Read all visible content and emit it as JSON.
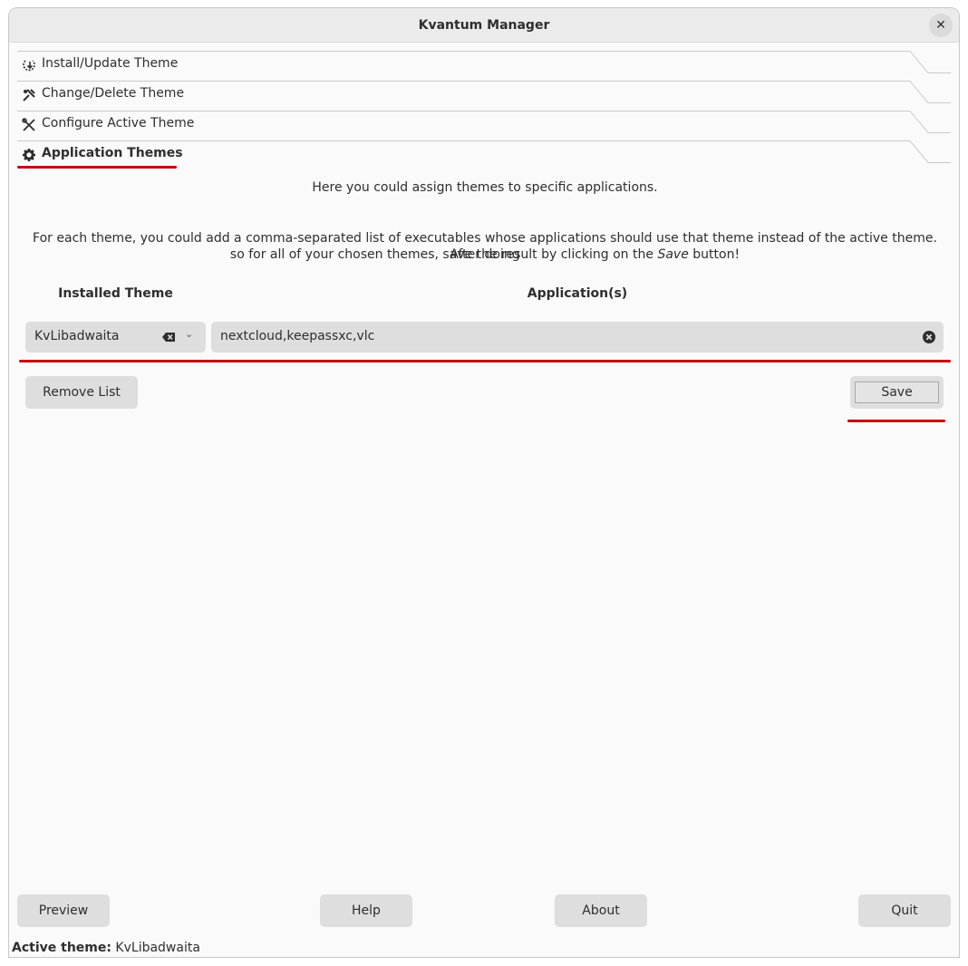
{
  "window": {
    "title": "Kvantum Manager"
  },
  "toolbox": [
    {
      "label": "Install/Update Theme",
      "icon": "install-icon"
    },
    {
      "label": "Change/Delete Theme",
      "icon": "change-icon"
    },
    {
      "label": "Configure Active Theme",
      "icon": "configure-icon"
    },
    {
      "label": "Application Themes",
      "icon": "gear-icon",
      "active": true
    }
  ],
  "page": {
    "intro": "Here you could assign themes to specific applications.",
    "description_line1": "For each theme, you could add a comma-separated list of executables whose applications should use that theme instead of the active theme. After doing",
    "description_line2_pre": "so for all of your chosen themes, save the result by clicking on the ",
    "description_line2_em": "Save",
    "description_line2_post": " button!",
    "col_installed_theme": "Installed Theme",
    "col_applications": "Application(s)",
    "theme_value": "KvLibadwaita",
    "applications_value": "nextcloud,keepassxc,vlc",
    "remove_list": "Remove List",
    "save": "Save"
  },
  "footer": {
    "preview": "Preview",
    "help": "Help",
    "about": "About",
    "quit": "Quit"
  },
  "status": {
    "label": "Active theme:",
    "value": "KvLibadwaita"
  },
  "colors": {
    "annotation_red": "#c4000f",
    "button_bg": "#dedede",
    "window_bg": "#fafafa"
  }
}
